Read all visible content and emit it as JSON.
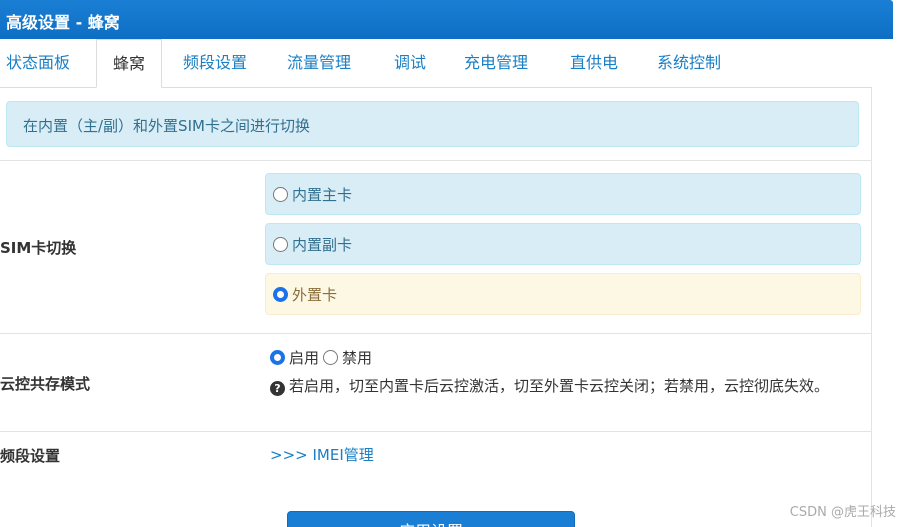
{
  "window": {
    "title": "高级设置 - 蜂窝"
  },
  "tabs": [
    {
      "label": "状态面板"
    },
    {
      "label": "蜂窝"
    },
    {
      "label": "频段设置"
    },
    {
      "label": "流量管理"
    },
    {
      "label": "调试"
    },
    {
      "label": "充电管理"
    },
    {
      "label": "直供电"
    },
    {
      "label": "系统控制"
    }
  ],
  "active_tab": "蜂窝",
  "info": {
    "text": "在内置（主/副）和外置SIM卡之间进行切换"
  },
  "sim_switch": {
    "label": "SIM卡切换",
    "options": [
      {
        "label": "内置主卡",
        "checked": false
      },
      {
        "label": "内置副卡",
        "checked": false
      },
      {
        "label": "外置卡",
        "checked": true
      }
    ]
  },
  "cloud_mode": {
    "label": "云控共存模式",
    "options": [
      {
        "label": "启用",
        "checked": true
      },
      {
        "label": "禁用",
        "checked": false
      }
    ],
    "help_text": "若启用，切至内置卡后云控激活，切至外置卡云控关闭；若禁用，云控彻底失效。"
  },
  "band": {
    "label": "频段设置",
    "link": ">>>  IMEI管理"
  },
  "apply_button": {
    "label": "应用设置"
  },
  "watermark": "CSDN @虎王科技",
  "colors": {
    "title_bar": "#1a7fd4",
    "tab_link": "#1a7fc4",
    "info_bg": "#d9edf7",
    "warning_bg": "#fcf8e3",
    "radio_checked": "#1a73e8"
  }
}
